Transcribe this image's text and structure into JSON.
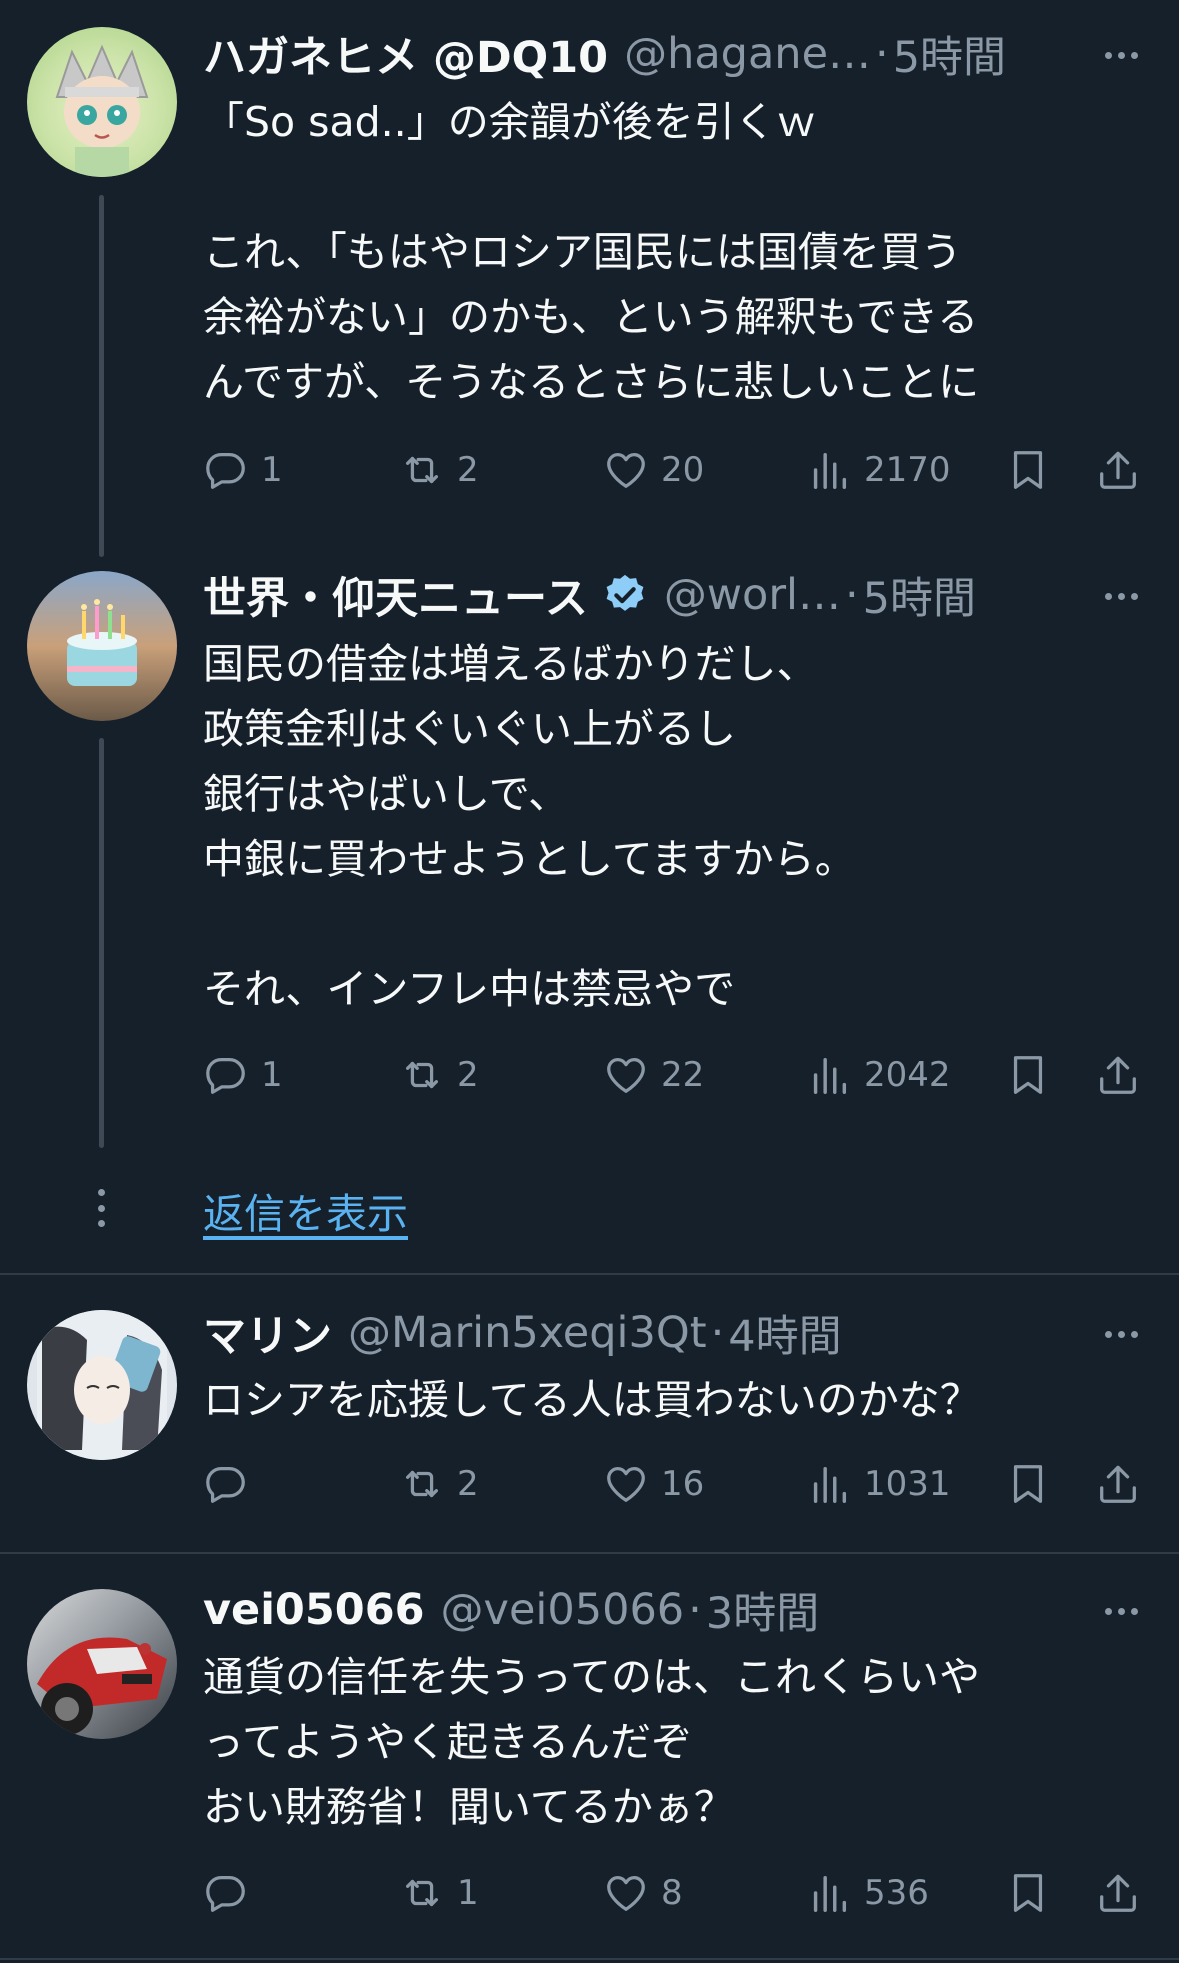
{
  "tweets": [
    {
      "name": "ハガネヒメ @DQ10",
      "handle": "@hagane…",
      "dot": "·",
      "time": "5時間",
      "text": "「So sad..」の余韻が後を引くｗ\n\nこれ、「もはやロシア国民には国債を買う\n余裕がない」のかも、という解釈もできる\nんですが、そうなるとさらに悲しいことに",
      "replies": "1",
      "retweets": "2",
      "likes": "20",
      "views": "2170"
    },
    {
      "name": "世界・仰天ニュース",
      "verified": true,
      "handle": "@worl…",
      "dot": "·",
      "time": "5時間",
      "text": "国民の借金は増えるばかりだし、\n政策金利はぐいぐい上がるし\n銀行はやばいしで、\n中銀に買わせようとしてますから。\n\nそれ、インフレ中は禁忌やで",
      "replies": "1",
      "retweets": "2",
      "likes": "22",
      "views": "2042"
    },
    {
      "name": "マリン",
      "handle": "@Marin5xeqi3Qt",
      "dot": "·",
      "time": "4時間",
      "text": "ロシアを応援してる人は買わないのかな？",
      "replies": "",
      "retweets": "2",
      "likes": "16",
      "views": "1031"
    },
    {
      "name": "vei05066",
      "handle": "@vei05066",
      "dot": "·",
      "time": "3時間",
      "text": "通貨の信任を失うってのは、これくらいや\nってようやく起きるんだぞ\nおい財務省！聞いてるかぁ？",
      "replies": "",
      "retweets": "1",
      "likes": "8",
      "views": "536"
    }
  ],
  "show_replies_label": "返信を表示",
  "colors": {
    "background": "#15202b",
    "text": "#f7f9f9",
    "muted": "#8b98a5",
    "link": "#5ab3f0",
    "verified": "#8ecdf8"
  }
}
